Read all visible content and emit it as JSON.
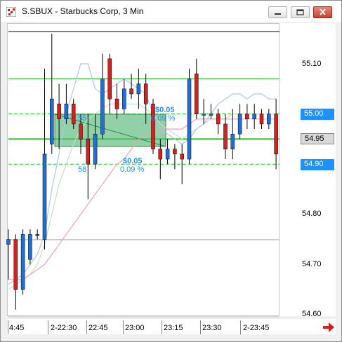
{
  "window": {
    "title": "S.SBUX - Starbucks Corp, 3 Min",
    "minimize_icon": "minimize-icon",
    "restore_icon": "restore-icon",
    "close_icon": "close-icon",
    "app_icon": "chart-app-icon"
  },
  "y_axis": {
    "labels": [
      "55.10",
      "55.00",
      "54.95",
      "54.90",
      "54.80",
      "54.70",
      "54.60"
    ],
    "badges": [
      {
        "label": "55.00",
        "bg": "#1e90ff",
        "color": "#ffffff"
      },
      {
        "label": "54.95",
        "bg": "#d9d9d9",
        "color": "#000000"
      },
      {
        "label": "54.90",
        "bg": "#1e90ff",
        "color": "#ffffff"
      }
    ]
  },
  "x_axis": {
    "labels": [
      "4:45",
      "2-22:30",
      "22:45",
      "23:00",
      "23:15",
      "23:30",
      "2-23:45"
    ]
  },
  "annotations": {
    "upper_price": "$0.05",
    "upper_pct": "0.09 %",
    "lower_price": "$0.05",
    "lower_pct": "0.09 %",
    "left_upper": "55",
    "left_lower": "58"
  },
  "colors": {
    "up": "#1e6fd9",
    "down": "#d62020",
    "level_green": "#22c322",
    "zone_fill": "#58b878",
    "ma_blue": "#a8c8ec",
    "ma_pink": "#f0a0b8",
    "ma_grey": "#c8dcc8"
  },
  "chart_data": {
    "type": "candlestick",
    "title": "S.SBUX - Starbucks Corp, 3 Min",
    "x_labels": [
      "4:45",
      "2-22:30",
      "22:45",
      "23:00",
      "23:15",
      "23:30",
      "2-23:45"
    ],
    "ylim": [
      54.585,
      55.185
    ],
    "y_ticks": [
      55.1,
      55.0,
      54.95,
      54.9,
      54.8,
      54.7,
      54.6
    ],
    "levels": [
      55.07,
      55.0,
      54.95,
      54.9
    ],
    "candles": [
      {
        "o": 54.74,
        "c": 54.75,
        "h": 54.77,
        "l": 54.67
      },
      {
        "o": 54.75,
        "c": 54.65,
        "h": 54.76,
        "l": 54.61
      },
      {
        "o": 54.65,
        "c": 54.76,
        "h": 54.77,
        "l": 54.64
      },
      {
        "o": 54.71,
        "c": 54.76,
        "h": 54.77,
        "l": 54.7
      },
      {
        "o": 54.76,
        "c": 54.76,
        "h": 54.77,
        "l": 54.75
      },
      {
        "o": 54.75,
        "c": 54.92,
        "h": 55.09,
        "l": 54.73
      },
      {
        "o": 54.94,
        "c": 55.03,
        "h": 55.16,
        "l": 54.92
      },
      {
        "o": 55.02,
        "c": 54.99,
        "h": 55.06,
        "l": 54.93
      },
      {
        "o": 54.99,
        "c": 55.02,
        "h": 55.06,
        "l": 54.98
      },
      {
        "o": 55.02,
        "c": 54.98,
        "h": 55.03,
        "l": 54.97
      },
      {
        "o": 54.98,
        "c": 54.95,
        "h": 55.0,
        "l": 54.92
      },
      {
        "o": 54.95,
        "c": 54.9,
        "h": 55.0,
        "l": 54.83
      },
      {
        "o": 54.9,
        "c": 54.96,
        "h": 55.0,
        "l": 54.89
      },
      {
        "o": 54.96,
        "c": 55.07,
        "h": 55.12,
        "l": 54.95
      },
      {
        "o": 55.11,
        "c": 55.03,
        "h": 55.12,
        "l": 55.0
      },
      {
        "o": 55.03,
        "c": 55.01,
        "h": 55.06,
        "l": 54.99
      },
      {
        "o": 55.01,
        "c": 55.05,
        "h": 55.07,
        "l": 55.0
      },
      {
        "o": 55.05,
        "c": 55.04,
        "h": 55.08,
        "l": 55.03
      },
      {
        "o": 55.04,
        "c": 55.06,
        "h": 55.09,
        "l": 55.01
      },
      {
        "o": 55.06,
        "c": 55.02,
        "h": 55.08,
        "l": 54.98
      },
      {
        "o": 55.02,
        "c": 54.93,
        "h": 55.03,
        "l": 54.92
      },
      {
        "o": 54.93,
        "c": 54.91,
        "h": 54.95,
        "l": 54.87
      },
      {
        "o": 54.91,
        "c": 54.93,
        "h": 54.95,
        "l": 54.9
      },
      {
        "o": 54.93,
        "c": 54.92,
        "h": 54.94,
        "l": 54.89
      },
      {
        "o": 54.92,
        "c": 54.91,
        "h": 54.94,
        "l": 54.86
      },
      {
        "o": 54.91,
        "c": 55.07,
        "h": 55.09,
        "l": 54.9
      },
      {
        "o": 55.08,
        "c": 55.0,
        "h": 55.11,
        "l": 54.99
      },
      {
        "o": 55.0,
        "c": 55.0,
        "h": 55.03,
        "l": 54.98
      },
      {
        "o": 55.0,
        "c": 55.0,
        "h": 55.02,
        "l": 54.99
      },
      {
        "o": 55.0,
        "c": 54.98,
        "h": 55.01,
        "l": 54.96
      },
      {
        "o": 54.98,
        "c": 54.93,
        "h": 55.0,
        "l": 54.91
      },
      {
        "o": 54.93,
        "c": 54.96,
        "h": 55.01,
        "l": 54.91
      },
      {
        "o": 54.96,
        "c": 55.0,
        "h": 55.02,
        "l": 54.95
      },
      {
        "o": 55.0,
        "c": 54.99,
        "h": 55.02,
        "l": 54.97
      },
      {
        "o": 54.99,
        "c": 55.0,
        "h": 55.02,
        "l": 54.97
      },
      {
        "o": 55.0,
        "c": 54.98,
        "h": 55.01,
        "l": 54.97
      },
      {
        "o": 54.98,
        "c": 55.0,
        "h": 55.01,
        "l": 54.97
      },
      {
        "o": 55.0,
        "c": 54.92,
        "h": 55.03,
        "l": 54.89
      }
    ],
    "ma_blue": [
      54.66,
      54.67,
      54.68,
      54.7,
      54.72,
      54.76,
      54.85,
      54.92,
      55.0,
      55.05,
      55.1,
      55.1,
      55.05,
      55.04,
      55.05,
      55.06,
      55.07,
      55.06,
      55.05,
      55.04,
      55.0,
      54.97,
      54.96,
      54.95,
      54.94,
      54.95,
      54.97,
      54.98,
      55.0,
      55.02,
      55.03,
      55.04,
      55.04,
      55.03,
      55.04,
      55.04,
      55.03,
      55.03
    ],
    "ma_pink": [
      54.67,
      54.67,
      54.67,
      54.68,
      54.69,
      54.7,
      54.72,
      54.74,
      54.76,
      54.78,
      54.8,
      54.82,
      54.84,
      54.86,
      54.88,
      54.9,
      54.91,
      54.93,
      54.95,
      54.96,
      54.96,
      54.97,
      54.97,
      54.97,
      54.97,
      54.98,
      54.99,
      54.99,
      54.99,
      54.99,
      54.99,
      54.99,
      54.99,
      54.99,
      54.99,
      54.99,
      54.99,
      54.99
    ],
    "ma_grey": [
      54.65,
      54.66,
      54.67,
      54.68,
      54.7,
      54.74,
      54.8,
      54.86,
      54.9,
      54.94,
      54.97,
      54.99,
      55.0,
      55.01,
      55.02,
      55.02,
      55.02,
      55.02,
      55.02,
      55.01,
      55.0,
      54.98,
      54.97,
      54.96,
      54.95,
      54.96,
      54.97,
      54.98,
      54.99,
      54.99,
      54.99,
      55.0,
      55.0,
      55.0,
      55.0,
      55.0,
      55.0,
      55.0
    ]
  }
}
